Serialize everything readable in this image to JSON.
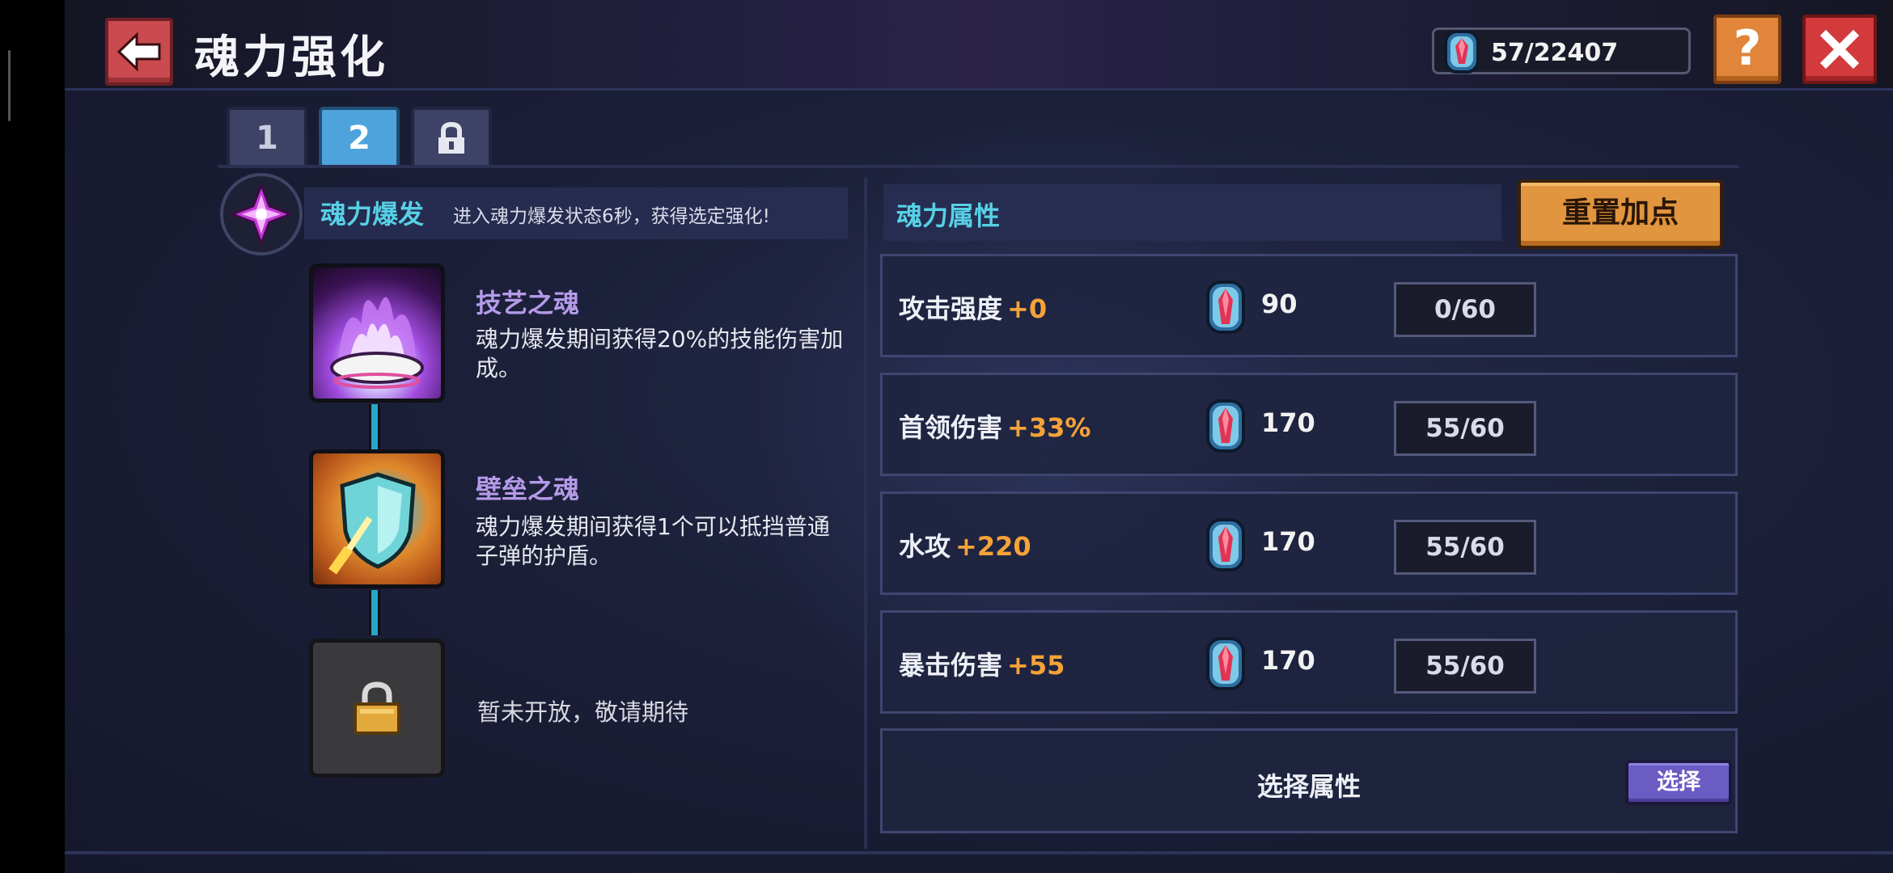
{
  "header": {
    "title": "魂力强化",
    "currency_value": "57/22407",
    "help_label": "?"
  },
  "tabs": [
    {
      "label": "1",
      "active": false
    },
    {
      "label": "2",
      "active": true
    },
    {
      "label": "",
      "icon": "lock-icon",
      "active": false
    }
  ],
  "burst": {
    "title": "魂力爆发",
    "description": "进入魂力爆发状态6秒，获得选定强化!"
  },
  "skills": [
    {
      "name": "技艺之魂",
      "description": "魂力爆发期间获得20%的技能伤害加成。",
      "icon": "purple-soul-flame-icon"
    },
    {
      "name": "壁垒之魂",
      "description": "魂力爆发期间获得1个可以抵挡普通子弹的护盾。",
      "icon": "shield-soul-icon"
    },
    {
      "name": "",
      "description": "暂未开放，敬请期待",
      "icon": "padlock-icon",
      "locked": true
    }
  ],
  "attributes": {
    "title": "魂力属性",
    "reset_label": "重置加点",
    "rows": [
      {
        "label": "攻击强度",
        "bonus": "+0",
        "cost": "90",
        "level": "0/60"
      },
      {
        "label": "首领伤害",
        "bonus": "+33%",
        "cost": "170",
        "level": "55/60"
      },
      {
        "label": "水攻",
        "bonus": "+220",
        "cost": "170",
        "level": "55/60"
      },
      {
        "label": "暴击伤害",
        "bonus": "+55",
        "cost": "170",
        "level": "55/60"
      }
    ],
    "select_row_label": "选择属性",
    "select_button_label": "选择"
  },
  "colors": {
    "accent_cyan": "#57d0e6",
    "bonus_orange": "#f5a238",
    "skill_name_purple": "#b49ae8",
    "reset_orange": "#e0953e",
    "close_red": "#d23a3c"
  }
}
